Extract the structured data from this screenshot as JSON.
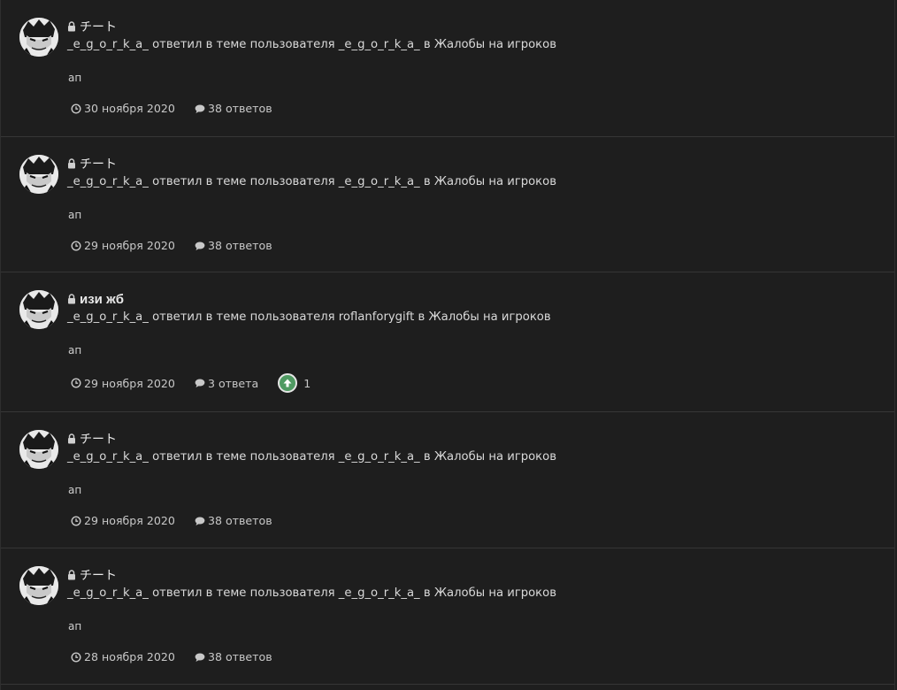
{
  "items": [
    {
      "title": "チート",
      "user": "_e_g_o_r_k_a_",
      "action": "ответил в теме пользователя",
      "topic_author": "_e_g_o_r_k_a_",
      "in_word": "в",
      "forum": "Жалобы на игроков",
      "snippet": "ап",
      "date": "30 ноября 2020",
      "replies": "38 ответов",
      "reputation": null,
      "icons": {
        "lock": "lock-icon",
        "clock": "clock-icon",
        "comment": "comment-icon"
      }
    },
    {
      "title": "チート",
      "user": "_e_g_o_r_k_a_",
      "action": "ответил в теме пользователя",
      "topic_author": "_e_g_o_r_k_a_",
      "in_word": "в",
      "forum": "Жалобы на игроков",
      "snippet": "ап",
      "date": "29 ноября 2020",
      "replies": "38 ответов",
      "reputation": null
    },
    {
      "title": "изи жб",
      "user": "_e_g_o_r_k_a_",
      "action": "ответил в теме пользователя",
      "topic_author": "roflanforygift",
      "in_word": "в",
      "forum": "Жалобы на игроков",
      "snippet": "ап",
      "date": "29 ноября 2020",
      "replies": "3 ответа",
      "reputation": "1"
    },
    {
      "title": "チート",
      "user": "_e_g_o_r_k_a_",
      "action": "ответил в теме пользователя",
      "topic_author": "_e_g_o_r_k_a_",
      "in_word": "в",
      "forum": "Жалобы на игроков",
      "snippet": "ап",
      "date": "29 ноября 2020",
      "replies": "38 ответов",
      "reputation": null
    },
    {
      "title": "チート",
      "user": "_e_g_o_r_k_a_",
      "action": "ответил в теме пользователя",
      "topic_author": "_e_g_o_r_k_a_",
      "in_word": "в",
      "forum": "Жалобы на игроков",
      "snippet": "ап",
      "date": "28 ноября 2020",
      "replies": "38 ответов",
      "reputation": null
    }
  ],
  "colors": {
    "background": "#1e1e1e",
    "divider": "#363636",
    "text": "#d9d9d9",
    "upvote": "#4f9a62"
  }
}
